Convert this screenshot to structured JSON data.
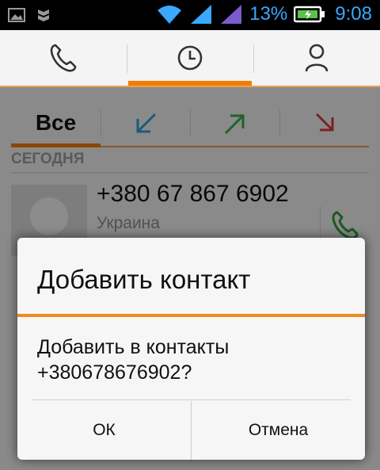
{
  "status_bar": {
    "battery_percent": "13%",
    "time": "9:08",
    "icons": [
      "image-icon",
      "shield-icon",
      "wifi-icon",
      "signal-icon",
      "signal-icon",
      "battery-charging-icon"
    ]
  },
  "top_tabs": [
    {
      "icon": "phone-icon",
      "active": false
    },
    {
      "icon": "clock-icon",
      "active": true
    },
    {
      "icon": "person-icon",
      "active": false
    }
  ],
  "filters": {
    "all_label": "Все",
    "items": [
      {
        "icon": "arrow-incoming-icon",
        "color": "#2a9fd6"
      },
      {
        "icon": "arrow-outgoing-icon",
        "color": "#3aa84a"
      },
      {
        "icon": "arrow-missed-icon",
        "color": "#d23a3a"
      }
    ]
  },
  "call_log": {
    "section_title": "СЕГОДНЯ",
    "entries": [
      {
        "number": "+380 67 867 6902",
        "location": "Украина"
      }
    ]
  },
  "dialog": {
    "title": "Добавить контакт",
    "message": "Добавить в контакты +380678676902?",
    "ok_label": "ОК",
    "cancel_label": "Отмена"
  },
  "colors": {
    "accent": "#f07d00",
    "status_text": "#3aa8ff",
    "call_green": "#2e9a3a"
  }
}
